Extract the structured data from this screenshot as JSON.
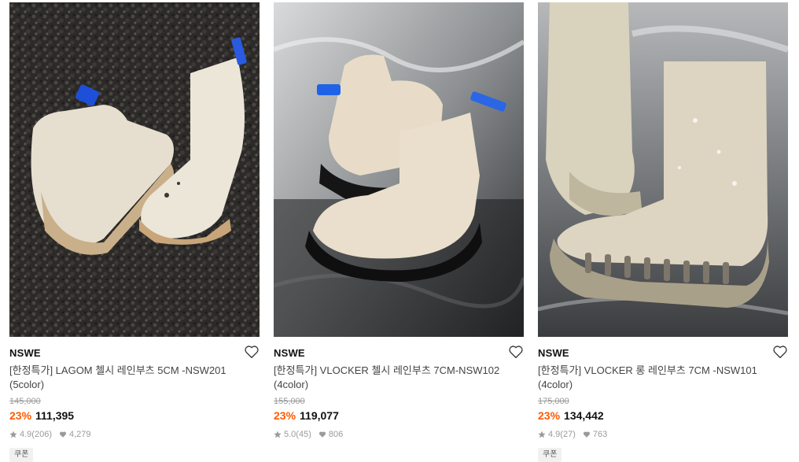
{
  "products": [
    {
      "brand": "NSWE",
      "title": "[한정특가] LAGOM 첼시 레인부츠 5CM -NSW201 (5color)",
      "original_price": "145,000",
      "discount": "23%",
      "price": "111,395",
      "rating": "4.9",
      "reviews": "(206)",
      "likes": "4,279",
      "coupon": "쿠폰"
    },
    {
      "brand": "NSWE",
      "title": "[한정특가] VLOCKER 첼시 레인부츠 7CM-NSW102 (4color)",
      "original_price": "155,000",
      "discount": "23%",
      "price": "119,077",
      "rating": "5.0",
      "reviews": "(45)",
      "likes": "806",
      "coupon": ""
    },
    {
      "brand": "NSWE",
      "title": "[한정특가] VLOCKER 롱 레인부츠 7CM -NSW101 (4color)",
      "original_price": "175,000",
      "discount": "23%",
      "price": "134,442",
      "rating": "4.9",
      "reviews": "(27)",
      "likes": "763",
      "coupon": "쿠폰"
    }
  ],
  "colors": {
    "discount": "#ff5a00",
    "muted": "#9a9a9a"
  },
  "icons": {
    "like": "heart-outline-icon",
    "rating": "star-icon",
    "likes": "heart-filled-icon"
  }
}
